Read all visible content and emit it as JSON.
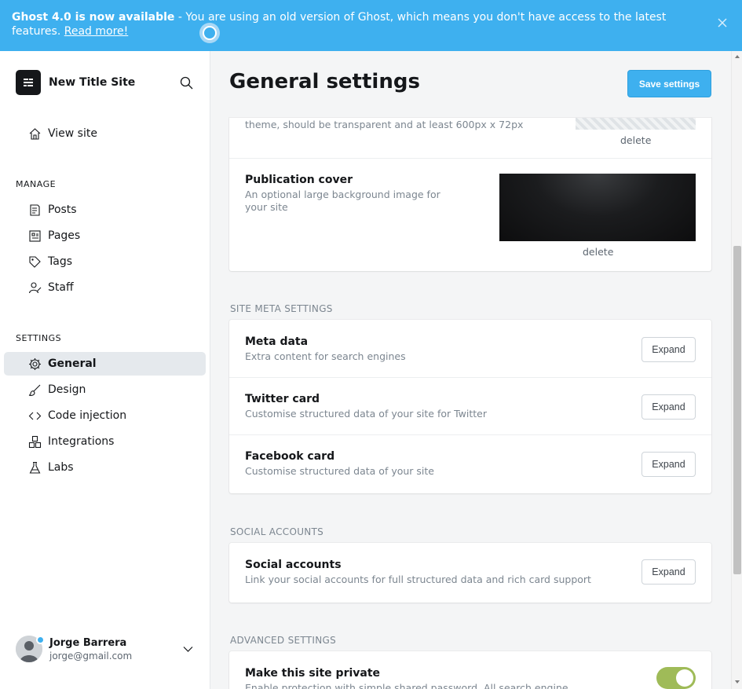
{
  "banner": {
    "strong": "Ghost 4.0 is now available",
    "text": " - You are using an old version of Ghost, which means you don't have access to the latest features. ",
    "link": "Read more!",
    "bg_color": "#3eb0ef"
  },
  "sidebar": {
    "site_title": "New Title Site",
    "view_site": "View site",
    "manage_heading": "MANAGE",
    "manage_items": [
      {
        "label": "Posts",
        "icon": "posts-icon"
      },
      {
        "label": "Pages",
        "icon": "pages-icon"
      },
      {
        "label": "Tags",
        "icon": "tag-icon"
      },
      {
        "label": "Staff",
        "icon": "staff-icon"
      }
    ],
    "settings_heading": "SETTINGS",
    "settings_items": [
      {
        "label": "General",
        "icon": "gear-icon",
        "active": true
      },
      {
        "label": "Design",
        "icon": "brush-icon"
      },
      {
        "label": "Code injection",
        "icon": "code-icon"
      },
      {
        "label": "Integrations",
        "icon": "integrations-icon"
      },
      {
        "label": "Labs",
        "icon": "flask-icon"
      }
    ],
    "user": {
      "name": "Jorge Barrera",
      "email": "jorge@gmail.com"
    }
  },
  "header": {
    "title": "General settings",
    "save_label": "Save settings"
  },
  "publication": {
    "logo_desc_partial": "theme, should be transparent and at least 600px x 72px",
    "logo_delete": "delete",
    "cover_title": "Publication cover",
    "cover_desc": "An optional large background image for your site",
    "cover_delete": "delete"
  },
  "site_meta": {
    "heading": "SITE META SETTINGS",
    "rows": [
      {
        "title": "Meta data",
        "desc": "Extra content for search engines",
        "button": "Expand"
      },
      {
        "title": "Twitter card",
        "desc": "Customise structured data of your site for Twitter",
        "button": "Expand"
      },
      {
        "title": "Facebook card",
        "desc": "Customise structured data of your site",
        "button": "Expand"
      }
    ]
  },
  "social": {
    "heading": "SOCIAL ACCOUNTS",
    "title": "Social accounts",
    "desc": "Link your social accounts for full structured data and rich card support",
    "button": "Expand"
  },
  "advanced": {
    "heading": "ADVANCED SETTINGS",
    "private_title": "Make this site private",
    "private_desc": "Enable protection with simple shared password. All search engine",
    "private_enabled": true,
    "toggle_color": "#9fbb58"
  }
}
